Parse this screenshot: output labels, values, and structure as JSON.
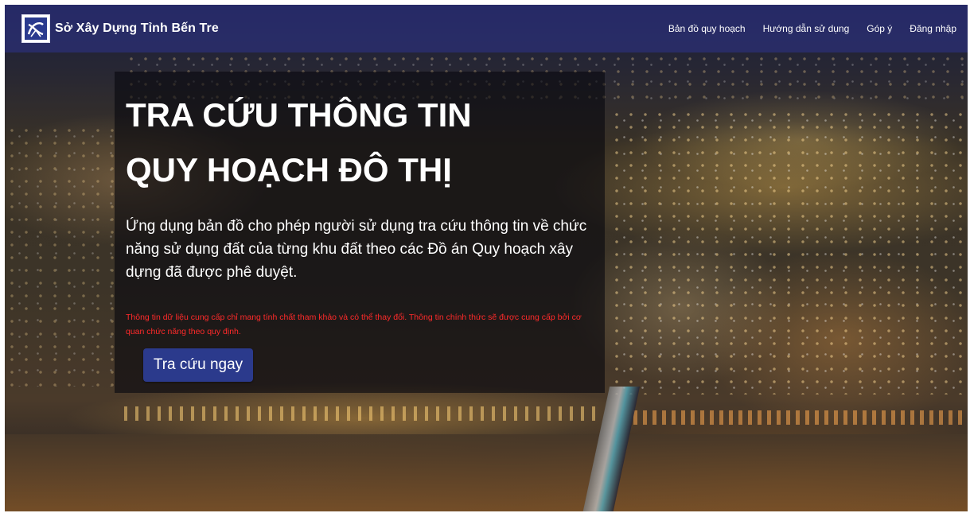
{
  "brand": {
    "name": "Sở Xây Dựng Tỉnh Bến Tre",
    "logo_icon": "building-emblem-icon"
  },
  "nav": {
    "items": [
      {
        "label": "Bản đồ quy hoạch"
      },
      {
        "label": "Hướng dẫn sử dụng"
      },
      {
        "label": "Góp ý"
      },
      {
        "label": "Đăng nhập"
      }
    ]
  },
  "hero": {
    "title_line1": "TRA CỨU THÔNG TIN",
    "title_line2": "QUY HOẠCH ĐÔ THỊ",
    "description": "Ứng dụng bản đồ cho phép người sử dụng tra cứu thông tin về chức năng sử dụng đất của từng khu đất theo các Đồ án Quy hoạch xây dựng đã được phê duyệt.",
    "note": "Thông tin dữ liệu cung cấp chỉ mang tính chất tham khảo và có thể thay đổi. Thông tin chính thức sẽ được cung cấp bởi cơ quan chức năng theo quy định.",
    "cta_label": "Tra cứu ngay"
  },
  "colors": {
    "navbar": "#2d3282",
    "cta": "#2b3a8c",
    "note": "#ff2a2a"
  }
}
